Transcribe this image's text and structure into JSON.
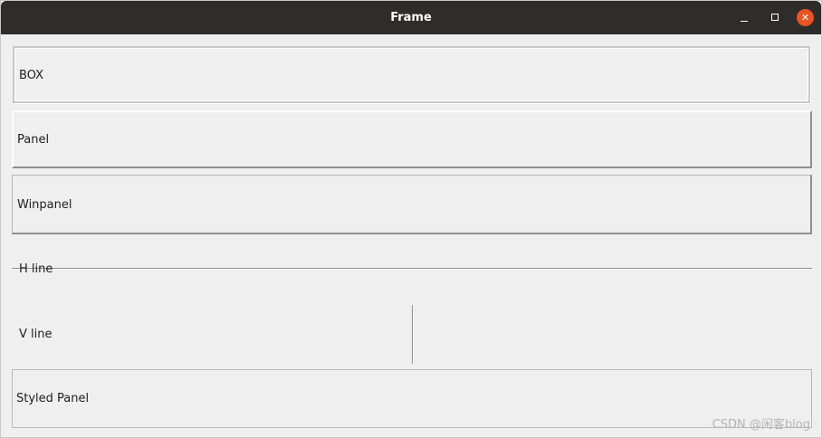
{
  "window": {
    "title": "Frame",
    "controls": {
      "minimize_icon": "minimize-icon",
      "maximize_icon": "maximize-icon",
      "close_icon": "close-icon",
      "close_color": "#e95420"
    }
  },
  "items": {
    "box_label": "BOX",
    "panel_label": "Panel",
    "winpanel_label": "Winpanel",
    "hline_label": "H line",
    "vline_label": "V line",
    "styled_panel_label": "Styled Panel"
  },
  "watermark": "CSDN @闲客blog"
}
